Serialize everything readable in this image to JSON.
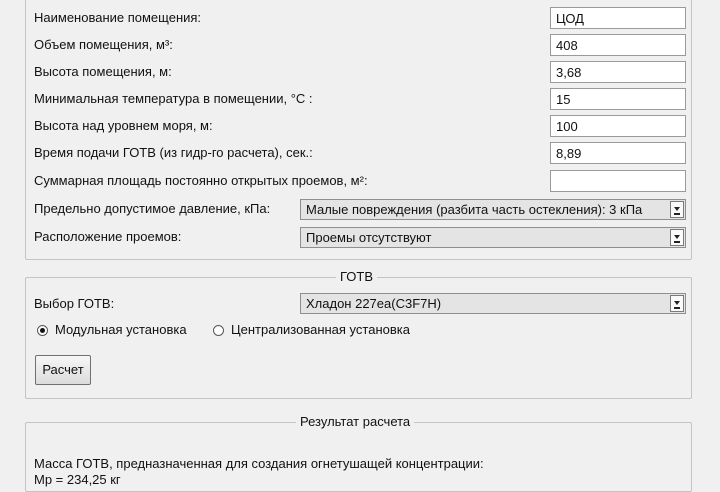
{
  "room": {
    "fields": [
      {
        "label": "Наименование помещения:",
        "value": "ЦОД"
      },
      {
        "label": "Объем помещения, м³:",
        "value": "408"
      },
      {
        "label": "Высота помещения, м:",
        "value": "3,68"
      },
      {
        "label": "Минимальная температура в помещении, °С :",
        "value": "15"
      },
      {
        "label": "Высота над уровнем моря, м:",
        "value": "100"
      },
      {
        "label": "Время подачи ГОТВ (из гидр-го расчета), сек.:",
        "value": "8,89"
      },
      {
        "label": "Суммарная площадь постоянно открытых проемов, м²:",
        "value": ""
      }
    ],
    "pressure": {
      "label": "Предельно допустимое давление, кПа:",
      "value": "Малые повреждения (разбита часть остекления): 3 кПа"
    },
    "openings": {
      "label": "Расположение проемов:",
      "value": "Проемы отсутствуют"
    }
  },
  "gotv": {
    "title": "ГОТВ",
    "select": {
      "label": "Выбор ГОТВ:",
      "value": "Хладон 227еа(C3F7H)"
    },
    "install_types": [
      {
        "label": "Модульная установка",
        "selected": true
      },
      {
        "label": "Централизованная установка",
        "selected": false
      }
    ],
    "calc_button": "Расчет"
  },
  "result": {
    "title": "Результат расчета",
    "text": "Масса ГОТВ, предназначенная для создания огнетушащей концентрации:",
    "mass": "Мр = 234,25 кг"
  }
}
